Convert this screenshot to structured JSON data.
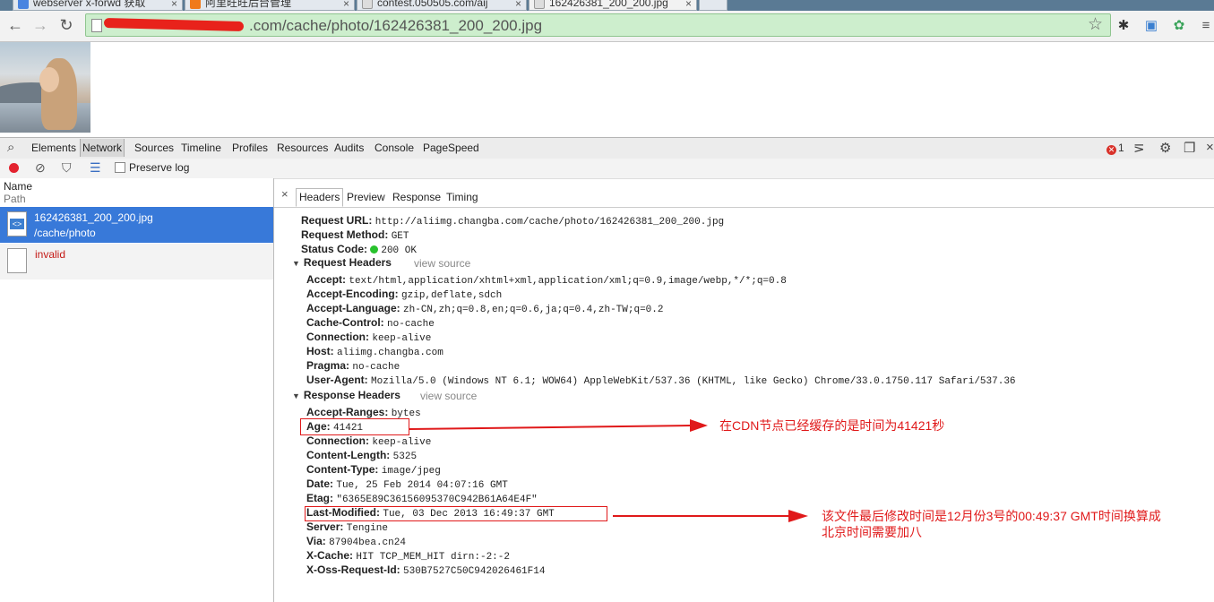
{
  "browser": {
    "tabs": [
      {
        "title": "webserver x-forwd 获取"
      },
      {
        "title": "阿里旺旺后台管理"
      },
      {
        "title": "contest.050505.com/aij"
      },
      {
        "title": "162426381_200_200.jpg"
      }
    ],
    "url": "aliimg.changba.com/cache/photo/162426381_200_200.jpg",
    "url_visible_suffix": ".com/cache/photo/162426381_200_200.jpg"
  },
  "devtools": {
    "panels": [
      "Elements",
      "Network",
      "Sources",
      "Timeline",
      "Profiles",
      "Resources",
      "Audits",
      "Console",
      "PageSpeed"
    ],
    "selected_panel": "Network",
    "error_count": "1",
    "preserve_log_label": "Preserve log",
    "columns": {
      "name": "Name",
      "path": "Path"
    },
    "requests": [
      {
        "name": "162426381_200_200.jpg",
        "path": "/cache/photo",
        "selected": true
      },
      {
        "name": "invalid",
        "path": "",
        "selected": false
      }
    ],
    "detail_tabs": [
      "Headers",
      "Preview",
      "Response",
      "Timing"
    ],
    "selected_detail_tab": "Headers",
    "general": [
      {
        "k": "Request URL:",
        "v": "http://aliimg.changba.com/cache/photo/162426381_200_200.jpg"
      },
      {
        "k": "Request Method:",
        "v": "GET"
      },
      {
        "k": "Status Code:",
        "v": "200 OK"
      }
    ],
    "request_headers_title": "Request Headers",
    "view_source": "view source",
    "request_headers": [
      {
        "k": "Accept:",
        "v": "text/html,application/xhtml+xml,application/xml;q=0.9,image/webp,*/*;q=0.8"
      },
      {
        "k": "Accept-Encoding:",
        "v": "gzip,deflate,sdch"
      },
      {
        "k": "Accept-Language:",
        "v": "zh-CN,zh;q=0.8,en;q=0.6,ja;q=0.4,zh-TW;q=0.2"
      },
      {
        "k": "Cache-Control:",
        "v": "no-cache"
      },
      {
        "k": "Connection:",
        "v": "keep-alive"
      },
      {
        "k": "Host:",
        "v": "aliimg.changba.com"
      },
      {
        "k": "Pragma:",
        "v": "no-cache"
      },
      {
        "k": "User-Agent:",
        "v": "Mozilla/5.0 (Windows NT 6.1; WOW64) AppleWebKit/537.36 (KHTML, like Gecko) Chrome/33.0.1750.117 Safari/537.36"
      }
    ],
    "response_headers_title": "Response Headers",
    "response_headers": [
      {
        "k": "Accept-Ranges:",
        "v": "bytes"
      },
      {
        "k": "Age:",
        "v": "41421"
      },
      {
        "k": "Connection:",
        "v": "keep-alive"
      },
      {
        "k": "Content-Length:",
        "v": "5325"
      },
      {
        "k": "Content-Type:",
        "v": "image/jpeg"
      },
      {
        "k": "Date:",
        "v": "Tue, 25 Feb 2014 04:07:16 GMT"
      },
      {
        "k": "Etag:",
        "v": "\"6365E89C36156095370C942B61A64E4F\""
      },
      {
        "k": "Last-Modified:",
        "v": "Tue, 03 Dec 2013 16:49:37 GMT"
      },
      {
        "k": "Server:",
        "v": "Tengine"
      },
      {
        "k": "Via:",
        "v": "87904bea.cn24"
      },
      {
        "k": "X-Cache:",
        "v": "HIT TCP_MEM_HIT dirn:-2:-2"
      },
      {
        "k": "X-Oss-Request-Id:",
        "v": "530B7527C50C942026461F14"
      }
    ]
  },
  "annotations": {
    "age_note": "在CDN节点已经缓存的是时间为41421秒",
    "lastmod_note_line1": "该文件最后修改时间是12月份3号的00:49:37 GMT时间换算成",
    "lastmod_note_line2": "北京时间需要加八",
    "color": "#e0191a"
  }
}
